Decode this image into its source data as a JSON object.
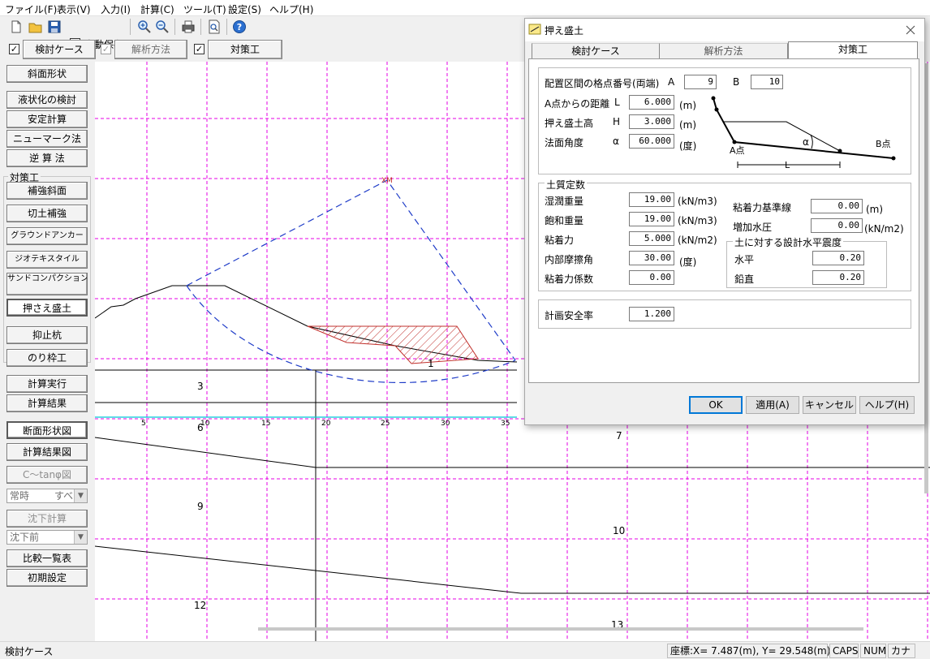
{
  "menu": [
    "ファイル(F)",
    "表示(V)",
    "入力(I)",
    "計算(C)",
    "ツール(T)",
    "設定(S)",
    "ヘルプ(H)"
  ],
  "toolbar": {
    "autosave_label": "自動保存"
  },
  "caserow": {
    "buttons": [
      {
        "label": "検討ケース",
        "checked": true,
        "enabled": true
      },
      {
        "label": "解析方法",
        "checked": true,
        "enabled": false
      },
      {
        "label": "対策工",
        "checked": true,
        "enabled": true
      }
    ]
  },
  "left_panel": {
    "slope_shape": "斜面形状",
    "liquefaction": "液状化の検討",
    "stability": "安定計算",
    "newmark": "ニューマーク法",
    "back_calc": "逆 算 法",
    "countermeasure_group": "対策工",
    "reinforced_slope": "補強斜面",
    "cut_reinforce": "切土補強",
    "ground_anchor": "グラウンドアンカー",
    "geotextile": "ジオテキスタイル",
    "sand_compaction": "サンドコンパクション パイル",
    "counterweight_fill": "押さえ盛土",
    "deterrent_pile": "抑止杭",
    "slope_frame": "のり枠工",
    "run_calc": "計算実行",
    "calc_result": "計算結果",
    "section_view": "断面形状図",
    "result_view": "計算結果図",
    "c_tan_view": "C〜tanφ図",
    "combo_case": "常時",
    "combo_case_right": "すべ",
    "settlement_calc": "沈下計算",
    "combo_settlement": "沈下前",
    "compare_list": "比較一覧表",
    "initial_settings": "初期設定"
  },
  "canvas": {
    "x_ticks": [
      "5",
      "10",
      "15",
      "20",
      "25",
      "30",
      "35"
    ],
    "layer_labels": [
      "1",
      "3",
      "6",
      "7",
      "9",
      "10",
      "12",
      "13"
    ],
    "center_label": "XM"
  },
  "status": {
    "mode": "検討ケース",
    "coords": "座標:X=   7.487(m), Y=  29.548(m)",
    "caps": "CAPS",
    "num": "NUM",
    "kana": "カナ"
  },
  "dialog": {
    "title": "押え盛土",
    "tabs": [
      "検討ケース",
      "解析方法",
      "対策工"
    ],
    "active_tab": 2,
    "placement": {
      "label": "配置区間の格点番号(両端)",
      "a_label": "A",
      "a_value": "9",
      "b_label": "B",
      "b_value": "10"
    },
    "distance": {
      "label": "A点からの距離",
      "sym": "L",
      "value": "6.000",
      "unit": "(m)"
    },
    "height": {
      "label": "押え盛土高",
      "sym": "H",
      "value": "3.000",
      "unit": "(m)"
    },
    "angle": {
      "label": "法面角度",
      "sym": "α",
      "value": "60.000",
      "unit": "(度)"
    },
    "diagram_labels": {
      "a_point": "A点",
      "b_point": "B点",
      "alpha": "α",
      "l": "L"
    },
    "soil": {
      "title": "土質定数",
      "wet_weight": {
        "label": "湿潤重量",
        "value": "19.00",
        "unit": "(kN/m3)"
      },
      "sat_weight": {
        "label": "飽和重量",
        "value": "19.00",
        "unit": "(kN/m3)"
      },
      "cohesion": {
        "label": "粘着力",
        "value": "5.000",
        "unit": "(kN/m2)"
      },
      "friction": {
        "label": "内部摩擦角",
        "value": "30.00",
        "unit": "(度)"
      },
      "cohesion_coef": {
        "label": "粘着力係数",
        "value": "0.00"
      },
      "cohesion_base": {
        "label": "粘着力基準線",
        "value": "0.00",
        "unit": "(m)"
      },
      "water_pressure": {
        "label": "増加水圧",
        "value": "0.00",
        "unit": "(kN/m2)"
      },
      "seismic": {
        "title": "土に対する設計水平震度",
        "horizontal": {
          "label": "水平",
          "value": "0.20"
        },
        "vertical": {
          "label": "鉛直",
          "value": "0.20"
        }
      }
    },
    "safety": {
      "label": "計画安全率",
      "value": "1.200"
    },
    "buttons": {
      "ok": "OK",
      "apply": "適用(A)",
      "cancel": "キャンセル",
      "help": "ヘルプ(H)"
    }
  },
  "colors": {
    "grid": "#e600e6",
    "circle": "#1f3cc8",
    "hatch": "#c0302c",
    "water": "#00c8d8",
    "accent": "#0078d7"
  }
}
